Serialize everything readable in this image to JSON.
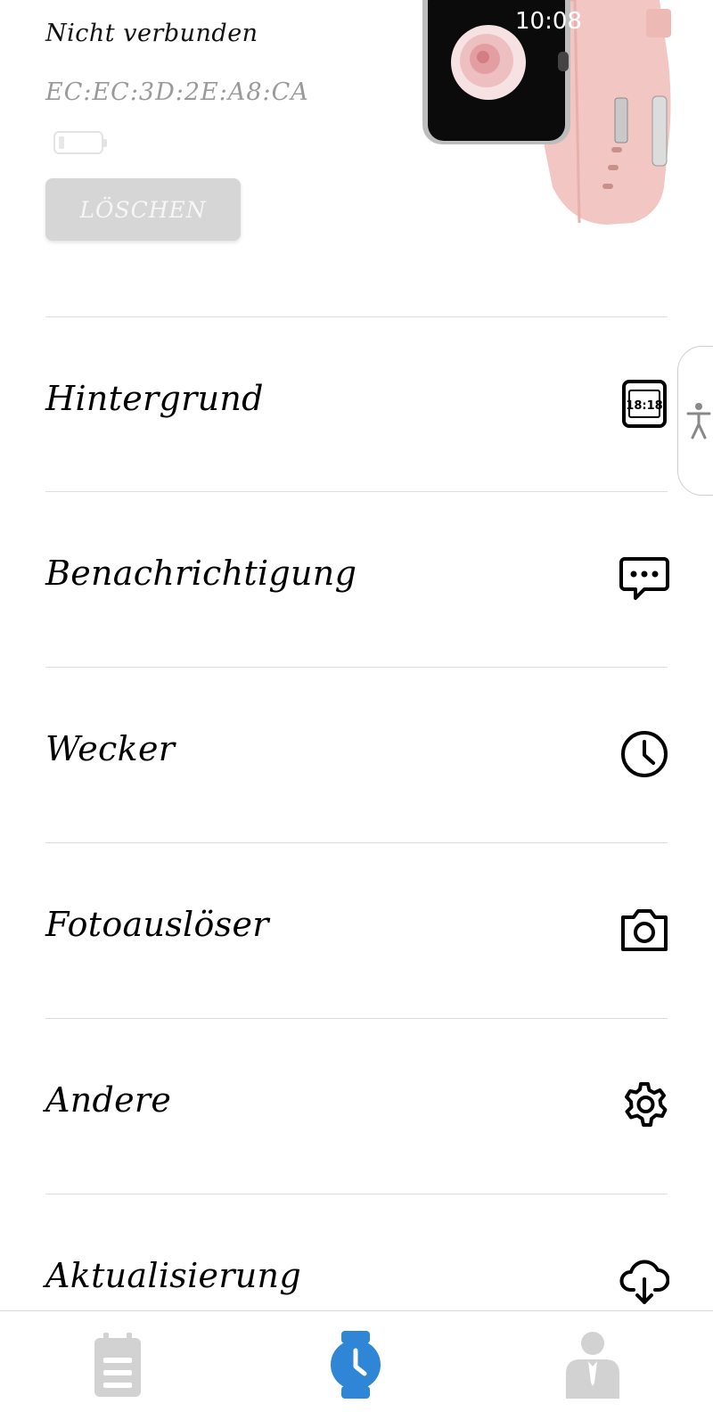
{
  "device": {
    "status": "Nicht verbunden",
    "mac": "EC:EC:3D:2E:A8:CA",
    "battery_level": 0.05,
    "delete_label": "LÖSCHEN",
    "watch_time": "10:08"
  },
  "menu": {
    "items": [
      {
        "label": "Hintergrund",
        "icon": "watchface-icon",
        "icon_text": "18:18"
      },
      {
        "label": "Benachrichtigung",
        "icon": "chat-bubble-icon"
      },
      {
        "label": "Wecker",
        "icon": "clock-icon"
      },
      {
        "label": "Fotoauslöser",
        "icon": "camera-icon"
      },
      {
        "label": "Andere",
        "icon": "gear-icon"
      },
      {
        "label": "Aktualisierung",
        "icon": "cloud-download-icon"
      }
    ]
  },
  "bottom_nav": {
    "items": [
      {
        "icon": "clipboard-icon",
        "active": false
      },
      {
        "icon": "watch-icon",
        "active": true
      },
      {
        "icon": "user-icon",
        "active": false
      }
    ]
  },
  "colors": {
    "accent": "#2f86d6",
    "inactive_nav": "#d2d2d2",
    "button_disabled": "#d6d6d6"
  }
}
